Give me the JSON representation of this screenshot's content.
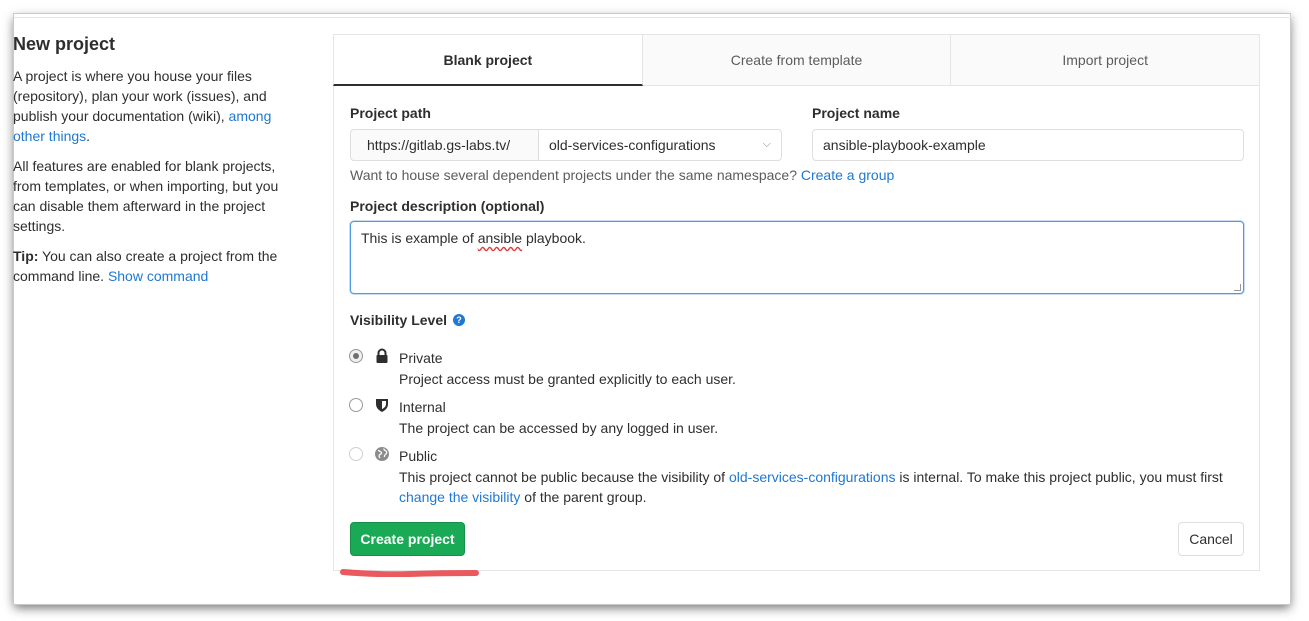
{
  "sidebar": {
    "title": "New project",
    "para1_text": "A project is where you house your files (repository), plan your work (issues), and publish your documentation (wiki),",
    "para1_link": "among other things",
    "para1_end": ".",
    "para2": "All features are enabled for blank projects, from templates, or when importing, but you can disable them afterward in the project settings.",
    "tip_label": "Tip:",
    "tip_text": "You can also create a project from the command line.",
    "tip_link": "Show command"
  },
  "tabs": [
    {
      "label": "Blank project",
      "active": true
    },
    {
      "label": "Create from template",
      "active": false
    },
    {
      "label": "Import project",
      "active": false
    }
  ],
  "form": {
    "path_label": "Project path",
    "path_prefix": "https://gitlab.gs-labs.tv/",
    "namespace_selected": "old-services-configurations",
    "name_label": "Project name",
    "name_value": "ansible-playbook-example",
    "namespace_help": "Want to house several dependent projects under the same namespace?",
    "namespace_help_link": "Create a group",
    "description_label": "Project description (optional)",
    "description_value_pre": "This is example of ",
    "description_value_misspelled": "ansible",
    "description_value_post": " playbook.",
    "visibility_label": "Visibility Level",
    "visibility_help_icon": "question-circle-icon",
    "options": [
      {
        "title": "Private",
        "icon": "lock-icon",
        "description": "Project access must be granted explicitly to each user.",
        "checked": true
      },
      {
        "title": "Internal",
        "icon": "shield-icon",
        "description": "The project can be accessed by any logged in user.",
        "checked": false
      },
      {
        "title": "Public",
        "icon": "globe-icon",
        "checked": false,
        "disabled": true,
        "description_pre": "This project cannot be public because the visibility of",
        "description_link1": "old-services-configurations",
        "description_mid": "is internal. To make this project public, you must first",
        "description_link2": "change the visibility",
        "description_post": "of the parent group."
      }
    ],
    "create_label": "Create project",
    "cancel_label": "Cancel"
  },
  "colors": {
    "link": "#1f78d1",
    "create_button": "#1aaa55",
    "annotation_mark": "#e8474b"
  }
}
